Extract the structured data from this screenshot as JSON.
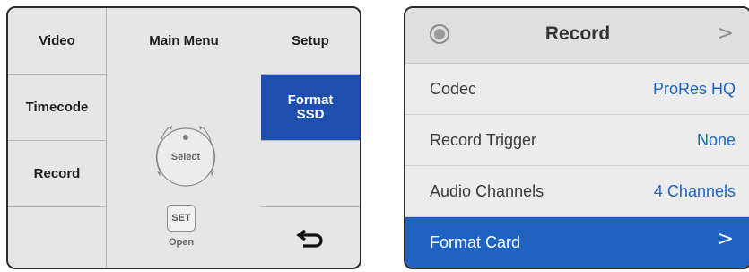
{
  "main_menu": {
    "title": "Main Menu",
    "video_label": "Video",
    "timecode_label": "Timecode",
    "record_label": "Record",
    "setup_label": "Setup",
    "format_line1": "Format",
    "format_line2": "SSD",
    "select_label": "Select",
    "set_label": "SET",
    "open_label": "Open",
    "back_icon": "back-arrow-icon"
  },
  "record_menu": {
    "title": "Record",
    "header_chevron": ">",
    "rows": [
      {
        "label": "Codec",
        "value": "ProRes HQ"
      },
      {
        "label": "Record Trigger",
        "value": "None"
      },
      {
        "label": "Audio Channels",
        "value": "4 Channels"
      }
    ],
    "format_card": {
      "label": "Format Card",
      "chevron": ">"
    }
  },
  "colors": {
    "highlight": "#1f4fae",
    "active_row": "#1e62c2",
    "value_text": "#1f64c4"
  }
}
